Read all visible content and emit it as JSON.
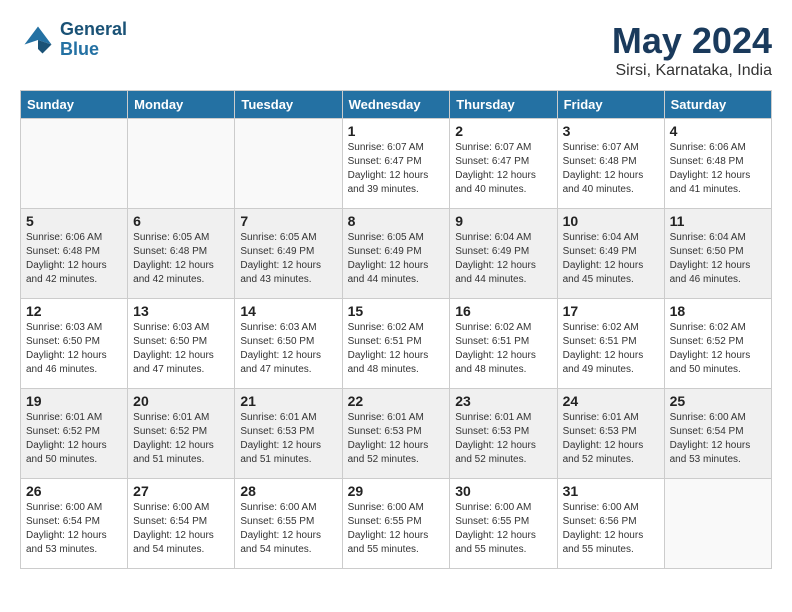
{
  "header": {
    "logo_line1": "General",
    "logo_line2": "Blue",
    "month_title": "May 2024",
    "location": "Sirsi, Karnataka, India"
  },
  "weekdays": [
    "Sunday",
    "Monday",
    "Tuesday",
    "Wednesday",
    "Thursday",
    "Friday",
    "Saturday"
  ],
  "weeks": [
    [
      {
        "day": "",
        "info": ""
      },
      {
        "day": "",
        "info": ""
      },
      {
        "day": "",
        "info": ""
      },
      {
        "day": "1",
        "info": "Sunrise: 6:07 AM\nSunset: 6:47 PM\nDaylight: 12 hours\nand 39 minutes."
      },
      {
        "day": "2",
        "info": "Sunrise: 6:07 AM\nSunset: 6:47 PM\nDaylight: 12 hours\nand 40 minutes."
      },
      {
        "day": "3",
        "info": "Sunrise: 6:07 AM\nSunset: 6:48 PM\nDaylight: 12 hours\nand 40 minutes."
      },
      {
        "day": "4",
        "info": "Sunrise: 6:06 AM\nSunset: 6:48 PM\nDaylight: 12 hours\nand 41 minutes."
      }
    ],
    [
      {
        "day": "5",
        "info": "Sunrise: 6:06 AM\nSunset: 6:48 PM\nDaylight: 12 hours\nand 42 minutes."
      },
      {
        "day": "6",
        "info": "Sunrise: 6:05 AM\nSunset: 6:48 PM\nDaylight: 12 hours\nand 42 minutes."
      },
      {
        "day": "7",
        "info": "Sunrise: 6:05 AM\nSunset: 6:49 PM\nDaylight: 12 hours\nand 43 minutes."
      },
      {
        "day": "8",
        "info": "Sunrise: 6:05 AM\nSunset: 6:49 PM\nDaylight: 12 hours\nand 44 minutes."
      },
      {
        "day": "9",
        "info": "Sunrise: 6:04 AM\nSunset: 6:49 PM\nDaylight: 12 hours\nand 44 minutes."
      },
      {
        "day": "10",
        "info": "Sunrise: 6:04 AM\nSunset: 6:49 PM\nDaylight: 12 hours\nand 45 minutes."
      },
      {
        "day": "11",
        "info": "Sunrise: 6:04 AM\nSunset: 6:50 PM\nDaylight: 12 hours\nand 46 minutes."
      }
    ],
    [
      {
        "day": "12",
        "info": "Sunrise: 6:03 AM\nSunset: 6:50 PM\nDaylight: 12 hours\nand 46 minutes."
      },
      {
        "day": "13",
        "info": "Sunrise: 6:03 AM\nSunset: 6:50 PM\nDaylight: 12 hours\nand 47 minutes."
      },
      {
        "day": "14",
        "info": "Sunrise: 6:03 AM\nSunset: 6:50 PM\nDaylight: 12 hours\nand 47 minutes."
      },
      {
        "day": "15",
        "info": "Sunrise: 6:02 AM\nSunset: 6:51 PM\nDaylight: 12 hours\nand 48 minutes."
      },
      {
        "day": "16",
        "info": "Sunrise: 6:02 AM\nSunset: 6:51 PM\nDaylight: 12 hours\nand 48 minutes."
      },
      {
        "day": "17",
        "info": "Sunrise: 6:02 AM\nSunset: 6:51 PM\nDaylight: 12 hours\nand 49 minutes."
      },
      {
        "day": "18",
        "info": "Sunrise: 6:02 AM\nSunset: 6:52 PM\nDaylight: 12 hours\nand 50 minutes."
      }
    ],
    [
      {
        "day": "19",
        "info": "Sunrise: 6:01 AM\nSunset: 6:52 PM\nDaylight: 12 hours\nand 50 minutes."
      },
      {
        "day": "20",
        "info": "Sunrise: 6:01 AM\nSunset: 6:52 PM\nDaylight: 12 hours\nand 51 minutes."
      },
      {
        "day": "21",
        "info": "Sunrise: 6:01 AM\nSunset: 6:53 PM\nDaylight: 12 hours\nand 51 minutes."
      },
      {
        "day": "22",
        "info": "Sunrise: 6:01 AM\nSunset: 6:53 PM\nDaylight: 12 hours\nand 52 minutes."
      },
      {
        "day": "23",
        "info": "Sunrise: 6:01 AM\nSunset: 6:53 PM\nDaylight: 12 hours\nand 52 minutes."
      },
      {
        "day": "24",
        "info": "Sunrise: 6:01 AM\nSunset: 6:53 PM\nDaylight: 12 hours\nand 52 minutes."
      },
      {
        "day": "25",
        "info": "Sunrise: 6:00 AM\nSunset: 6:54 PM\nDaylight: 12 hours\nand 53 minutes."
      }
    ],
    [
      {
        "day": "26",
        "info": "Sunrise: 6:00 AM\nSunset: 6:54 PM\nDaylight: 12 hours\nand 53 minutes."
      },
      {
        "day": "27",
        "info": "Sunrise: 6:00 AM\nSunset: 6:54 PM\nDaylight: 12 hours\nand 54 minutes."
      },
      {
        "day": "28",
        "info": "Sunrise: 6:00 AM\nSunset: 6:55 PM\nDaylight: 12 hours\nand 54 minutes."
      },
      {
        "day": "29",
        "info": "Sunrise: 6:00 AM\nSunset: 6:55 PM\nDaylight: 12 hours\nand 55 minutes."
      },
      {
        "day": "30",
        "info": "Sunrise: 6:00 AM\nSunset: 6:55 PM\nDaylight: 12 hours\nand 55 minutes."
      },
      {
        "day": "31",
        "info": "Sunrise: 6:00 AM\nSunset: 6:56 PM\nDaylight: 12 hours\nand 55 minutes."
      },
      {
        "day": "",
        "info": ""
      }
    ]
  ]
}
